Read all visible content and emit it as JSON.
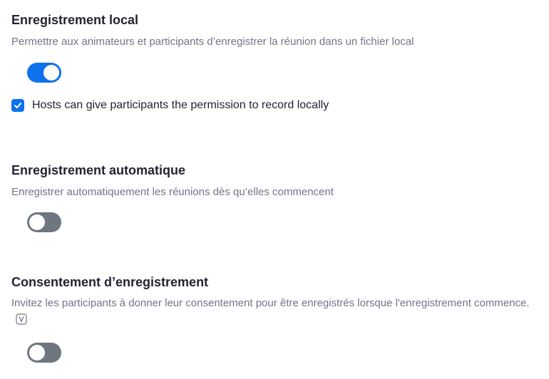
{
  "local_recording": {
    "title": "Enregistrement local",
    "description": "Permettre aux animateurs et participants d’enregistrer la réunion dans un fichier local",
    "enabled": true,
    "checkbox_label": "Hosts can give participants the permission to record locally",
    "checkbox_checked": true
  },
  "auto_recording": {
    "title": "Enregistrement automatique",
    "description": "Enregistrer automatiquement les réunions dès qu’elles commencent",
    "enabled": false
  },
  "recording_consent": {
    "title": "Consentement d’enregistrement",
    "description": "Invitez les participants à donner leur consentement pour être enregistrés lorsque l'enregistrement commence.",
    "enabled": false,
    "badge_icon": "version-v-icon"
  },
  "colors": {
    "accent": "#0e72ed",
    "toggle_off": "#6e7680",
    "title": "#232333",
    "description": "#747487"
  }
}
